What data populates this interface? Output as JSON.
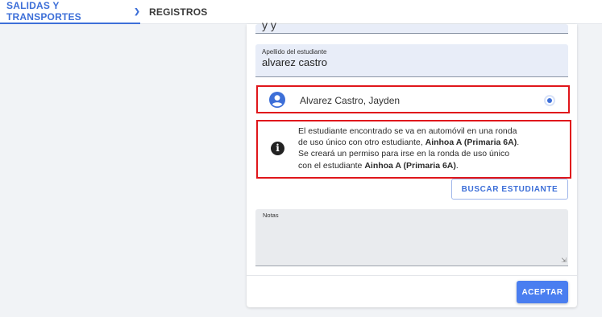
{
  "nav": {
    "tab_active_label": "SALIDAS Y TRANSPORTES",
    "tab_records_label": "REGISTROS"
  },
  "form": {
    "top_field_partial": "y y",
    "apellido_label": "Apellido del estudiante",
    "apellido_value": "alvarez castro",
    "student_result_name": "Alvarez Castro, Jayden",
    "student_result_selected": true,
    "info": {
      "line1": "El estudiante encontrado se va en automóvil en una ronda",
      "line2_pre": "de uso único con otro estudiante, ",
      "line2_bold": "Ainhoa A (Primaria 6A)",
      "line2_post": ".",
      "line3": "Se creará un permiso para irse en la ronda de uso único",
      "line4_pre": "con el estudiante ",
      "line4_bold": "Ainhoa A (Primaria 6A)",
      "line4_post": "."
    },
    "buscar_label": "BUSCAR ESTUDIANTE",
    "notes_label": "Notas",
    "notes_value": "",
    "aceptar_label": "ACEPTAR"
  },
  "icons": {
    "tab_dropdown": "chevron-down-icon",
    "student": "person-circle-icon",
    "info": "info-circle-icon",
    "resize": "resize-grip-icon"
  },
  "colors": {
    "accent": "#3d6fd8",
    "primary_button": "#4a7ef0",
    "highlight_border": "#e0161b",
    "field_bg": "#e8edf8"
  }
}
